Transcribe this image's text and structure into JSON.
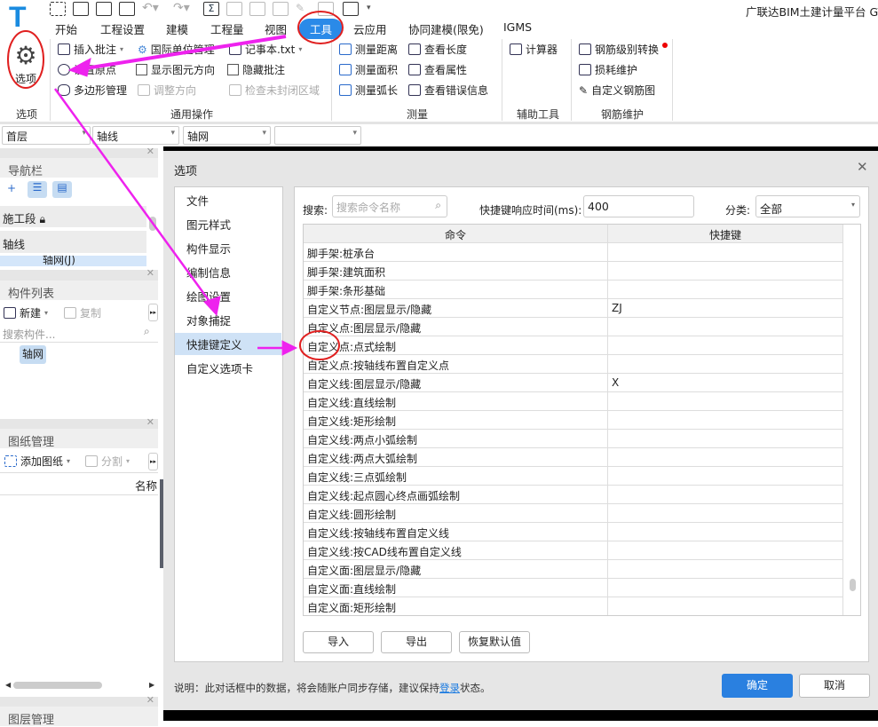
{
  "app": {
    "title": "广联达BIM土建计量平台 GT",
    "logo": "T"
  },
  "ribbon_tabs": [
    "开始",
    "工程设置",
    "建模",
    "工程量",
    "视图",
    "工具",
    "云应用",
    "协同建模(限免)",
    "IGMS"
  ],
  "active_tab": "工具",
  "ribbon": {
    "options_label": "选项",
    "options_group": "选项",
    "general": {
      "insert_note": "插入批注",
      "unit_mgmt": "国际单位管理",
      "notepad": "记事本.txt",
      "set_origin": "设置原点",
      "show_dir": "显示图元方向",
      "hide_note": "隐藏批注",
      "polygon": "多边形管理",
      "adjust_dir": "调整方向",
      "check_region": "检查未封闭区域",
      "group": "通用操作"
    },
    "measure": {
      "dist": "测量距离",
      "area": "测量面积",
      "arc": "测量弧长",
      "len": "查看长度",
      "attr": "查看属性",
      "err": "查看错误信息",
      "group": "测量"
    },
    "aux": {
      "calc": "计算器",
      "group": "辅助工具"
    },
    "rebar": {
      "convert": "钢筋级别转换",
      "loss": "损耗维护",
      "custom": "自定义钢筋图",
      "group": "钢筋维护"
    }
  },
  "selectors": {
    "floor": "首层",
    "type": "轴线",
    "sub": "轴网",
    "extra": ""
  },
  "left": {
    "nav_title": "导航栏",
    "nav_items": [
      "施工段",
      "轴线",
      "轴网(J)"
    ],
    "comp_title": "构件列表",
    "new": "新建",
    "copy": "复制",
    "search_placeholder": "搜索构件...",
    "comp_item": "轴网",
    "drawing_title": "图纸管理",
    "add_drawing": "添加图纸",
    "split": "分割",
    "col_name": "名称",
    "layer_title": "图层管理"
  },
  "dialog": {
    "title": "选项",
    "nav": [
      "文件",
      "图元样式",
      "构件显示",
      "编制信息",
      "绘图设置",
      "对象捕捉",
      "快捷键定义",
      "自定义选项卡"
    ],
    "selected_nav": "快捷键定义",
    "search_label": "搜索:",
    "search_placeholder": "搜索命令名称",
    "delay_label": "快捷键响应时间(ms):",
    "delay_value": "400",
    "category_label": "分类:",
    "category_value": "全部",
    "columns": [
      "命令",
      "快捷键"
    ],
    "rows": [
      [
        "脚手架:桩承台",
        ""
      ],
      [
        "脚手架:建筑面积",
        ""
      ],
      [
        "脚手架:条形基础",
        ""
      ],
      [
        "自定义节点:图层显示/隐藏",
        "ZJ"
      ],
      [
        "自定义点:图层显示/隐藏",
        ""
      ],
      [
        "自定义点:点式绘制",
        ""
      ],
      [
        "自定义点:按轴线布置自定义点",
        ""
      ],
      [
        "自定义线:图层显示/隐藏",
        "X"
      ],
      [
        "自定义线:直线绘制",
        ""
      ],
      [
        "自定义线:矩形绘制",
        ""
      ],
      [
        "自定义线:两点小弧绘制",
        ""
      ],
      [
        "自定义线:两点大弧绘制",
        ""
      ],
      [
        "自定义线:三点弧绘制",
        ""
      ],
      [
        "自定义线:起点圆心终点画弧绘制",
        ""
      ],
      [
        "自定义线:圆形绘制",
        ""
      ],
      [
        "自定义线:按轴线布置自定义线",
        ""
      ],
      [
        "自定义线:按CAD线布置自定义线",
        ""
      ],
      [
        "自定义面:图层显示/隐藏",
        ""
      ],
      [
        "自定义面:直线绘制",
        ""
      ],
      [
        "自定义面:矩形绘制",
        ""
      ]
    ],
    "import": "导入",
    "export": "导出",
    "restore": "恢复默认值",
    "note_prefix": "说明：此对话框中的数据，将会随账户同步存储，建议保持",
    "note_link": "登录",
    "note_suffix": "状态。",
    "ok": "确定",
    "cancel": "取消"
  },
  "colors": {
    "accent": "#2a8ae8",
    "annotation": "#ee22ee",
    "circle": "#e02020"
  }
}
